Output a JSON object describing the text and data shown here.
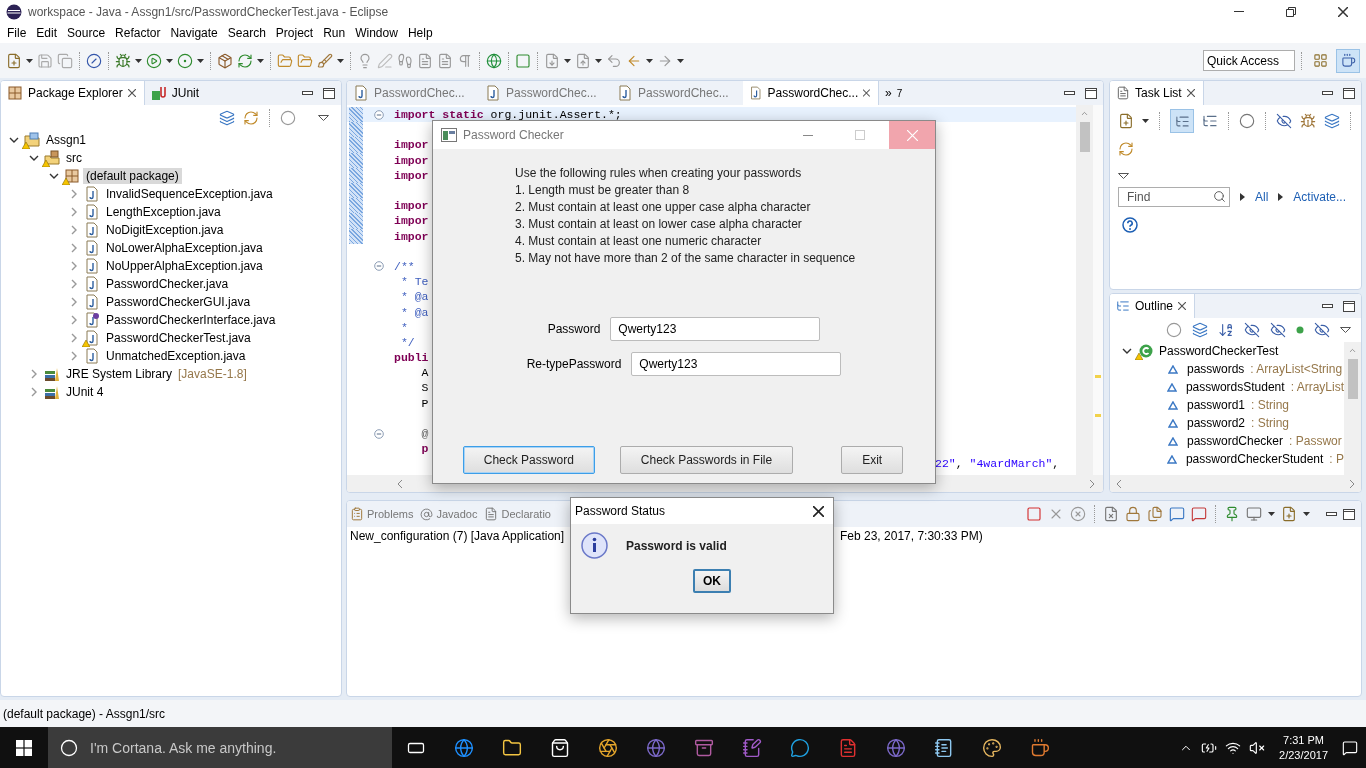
{
  "window": {
    "title": "workspace - Java - Assgn1/src/PasswordCheckerTest.java - Eclipse"
  },
  "menu": [
    {
      "label": "File"
    },
    {
      "label": "Edit"
    },
    {
      "label": "Source"
    },
    {
      "label": "Refactor"
    },
    {
      "label": "Navigate"
    },
    {
      "label": "Search"
    },
    {
      "label": "Project"
    },
    {
      "label": "Run"
    },
    {
      "label": "Window"
    },
    {
      "label": "Help"
    }
  ],
  "quick_access": {
    "placeholder": "Quick Access"
  },
  "package_explorer": {
    "tabs": [
      {
        "label": "Package Explorer",
        "selected": true,
        "kind": "explorer"
      },
      {
        "label": "JUnit",
        "selected": false,
        "kind": "junit"
      }
    ],
    "tree": [
      {
        "label": "Assgn1",
        "kind": "project",
        "expanded": true,
        "warning": true,
        "selected": false,
        "children": [
          {
            "label": "src",
            "kind": "source-folder",
            "expanded": true,
            "warning": true,
            "selected": false,
            "children": [
              {
                "label": "(default package)",
                "kind": "package",
                "expanded": true,
                "warning": true,
                "selected": true,
                "children": [
                  {
                    "label": "InvalidSequenceException.java",
                    "kind": "class",
                    "expanded": false,
                    "warning": false,
                    "selected": false
                  },
                  {
                    "label": "LengthException.java",
                    "kind": "class",
                    "expanded": false,
                    "warning": false,
                    "selected": false
                  },
                  {
                    "label": "NoDigitException.java",
                    "kind": "class",
                    "expanded": false,
                    "warning": false,
                    "selected": false
                  },
                  {
                    "label": "NoLowerAlphaException.java",
                    "kind": "class",
                    "expanded": false,
                    "warning": false,
                    "selected": false
                  },
                  {
                    "label": "NoUpperAlphaException.java",
                    "kind": "class",
                    "expanded": false,
                    "warning": false,
                    "selected": false
                  },
                  {
                    "label": "PasswordChecker.java",
                    "kind": "class",
                    "expanded": false,
                    "warning": false,
                    "selected": false
                  },
                  {
                    "label": "PasswordCheckerGUI.java",
                    "kind": "class",
                    "expanded": false,
                    "warning": false,
                    "selected": false
                  },
                  {
                    "label": "PasswordCheckerInterface.java",
                    "kind": "interface",
                    "expanded": false,
                    "warning": false,
                    "selected": false
                  },
                  {
                    "label": "PasswordCheckerTest.java",
                    "kind": "class",
                    "expanded": false,
                    "warning": true,
                    "selected": false
                  },
                  {
                    "label": "UnmatchedException.java",
                    "kind": "class",
                    "expanded": false,
                    "warning": false,
                    "selected": false
                  }
                ]
              }
            ]
          },
          {
            "label": "JRE System Library",
            "suffix": "[JavaSE-1.8]",
            "kind": "library",
            "expanded": false,
            "warning": false,
            "selected": false
          },
          {
            "label": "JUnit 4",
            "kind": "library",
            "expanded": false,
            "warning": false,
            "selected": false
          }
        ]
      }
    ]
  },
  "editor": {
    "tabs": [
      {
        "label": "PasswordChec...",
        "selected": false
      },
      {
        "label": "PasswordChec...",
        "selected": false
      },
      {
        "label": "PasswordChec...",
        "selected": false
      },
      {
        "label": "PasswordChec...",
        "selected": true
      }
    ],
    "overflow": {
      "glyph": "»",
      "count": "7"
    },
    "lines": [
      {
        "tokens": [
          {
            "text": "import static",
            "kind": "keyword"
          },
          {
            "text": " org.junit.Assert.*;",
            "kind": "plain"
          }
        ],
        "fold": true,
        "current": true,
        "marked": true
      },
      {
        "fold": false,
        "current": false,
        "marked": true
      },
      {
        "tokens": [
          {
            "text": "impor",
            "kind": "keyword"
          }
        ],
        "fold": false,
        "current": false,
        "marked": true
      },
      {
        "tokens": [
          {
            "text": "impor",
            "kind": "keyword"
          }
        ],
        "fold": false,
        "current": false,
        "marked": true
      },
      {
        "tokens": [
          {
            "text": "impor",
            "kind": "keyword"
          }
        ],
        "fold": false,
        "current": false,
        "marked": true
      },
      {
        "fold": false,
        "current": false,
        "marked": true
      },
      {
        "tokens": [
          {
            "text": "impor",
            "kind": "keyword"
          }
        ],
        "fold": false,
        "current": false,
        "marked": true
      },
      {
        "tokens": [
          {
            "text": "impor",
            "kind": "keyword"
          }
        ],
        "fold": false,
        "current": false,
        "marked": true
      },
      {
        "tokens": [
          {
            "text": "impor",
            "kind": "keyword"
          }
        ],
        "fold": false,
        "current": false,
        "marked": true
      },
      {
        "fold": false,
        "current": false,
        "marked": false
      },
      {
        "tokens": [
          {
            "text": "/**",
            "kind": "comment"
          }
        ],
        "fold": true,
        "current": false,
        "marked": false
      },
      {
        "tokens": [
          {
            "text": " * Te",
            "kind": "comment"
          }
        ],
        "fold": false,
        "current": false,
        "marked": false
      },
      {
        "tokens": [
          {
            "text": " * @a",
            "kind": "comment"
          }
        ],
        "fold": false,
        "current": false,
        "marked": false
      },
      {
        "tokens": [
          {
            "text": " * @a",
            "kind": "comment"
          }
        ],
        "fold": false,
        "current": false,
        "marked": false
      },
      {
        "tokens": [
          {
            "text": " *",
            "kind": "comment"
          }
        ],
        "fold": false,
        "current": false,
        "marked": false
      },
      {
        "tokens": [
          {
            "text": " */",
            "kind": "comment"
          }
        ],
        "fold": false,
        "current": false,
        "marked": false
      },
      {
        "tokens": [
          {
            "text": "publi",
            "kind": "keyword"
          }
        ],
        "fold": false,
        "current": false,
        "marked": false
      },
      {
        "tokens": [
          {
            "text": "    A",
            "kind": "plain"
          }
        ],
        "fold": false,
        "current": false,
        "marked": false
      },
      {
        "tokens": [
          {
            "text": "    S",
            "kind": "plain"
          }
        ],
        "fold": false,
        "current": false,
        "marked": false
      },
      {
        "tokens": [
          {
            "text": "    P",
            "kind": "plain"
          }
        ],
        "fold": false,
        "current": false,
        "marked": false
      },
      {
        "fold": false,
        "current": false,
        "marked": false
      },
      {
        "tokens": [
          {
            "text": "    @",
            "kind": "annotation"
          }
        ],
        "fold": true,
        "current": false,
        "marked": false
      },
      {
        "tokens": [
          {
            "text": "    p",
            "kind": "keyword"
          }
        ],
        "fold": false,
        "current": false,
        "marked": false
      },
      {
        "right": [
          {
            "text": "22\"",
            "kind": "string"
          },
          {
            "text": ", ",
            "kind": "plain"
          },
          {
            "text": "\"4wardMarch\"",
            "kind": "string"
          },
          {
            "text": ",",
            "kind": "plain"
          }
        ],
        "fold": false,
        "current": false,
        "marked": false
      }
    ]
  },
  "task_list": {
    "title": "Task List",
    "selected": true,
    "find": {
      "placeholder": "Find"
    },
    "links": [
      {
        "label": "All"
      },
      {
        "label": "Activate..."
      }
    ]
  },
  "outline": {
    "title": "Outline",
    "selected": true,
    "tree": [
      {
        "label": "PasswordCheckerTest",
        "kind": "class",
        "expanded": true,
        "warning": true,
        "children": [
          {
            "label": "passwords",
            "type": ": ArrayList<String",
            "kind": "field"
          },
          {
            "label": "passwordsStudent",
            "type": ": ArrayList",
            "kind": "field"
          },
          {
            "label": "password1",
            "type": ": String",
            "kind": "field"
          },
          {
            "label": "password2",
            "type": ": String",
            "kind": "field"
          },
          {
            "label": "passwordChecker",
            "type": ": Passwor",
            "kind": "field"
          },
          {
            "label": "passwordCheckerStudent",
            "type": ": P",
            "kind": "field"
          }
        ]
      }
    ]
  },
  "console": {
    "tabs": [
      {
        "label": "Problems",
        "kind": "problems",
        "selected": false
      },
      {
        "label": "Javadoc",
        "kind": "javadoc",
        "selected": false
      },
      {
        "label": "Declaratio",
        "kind": "declaration",
        "selected": false
      }
    ],
    "header": "New_configuration (7) [Java Application]",
    "header_end": "Feb 23, 2017, 7:30:33 PM)"
  },
  "password_checker": {
    "title": "Password Checker",
    "close_hovered": true,
    "instructions": [
      "Use the following rules when creating your passwords",
      "1. Length must be greater than 8",
      "2. Must contain at least one upper case alpha character",
      "3. Must contain at least on lower case alpha character",
      "4. Must contain at least one numeric character",
      "5. May not have more than 2 of the same character in sequence"
    ],
    "fields": [
      {
        "label": "Password",
        "value": "Qwerty123"
      },
      {
        "label": "Re-typePassword",
        "value": "Qwerty123"
      }
    ],
    "buttons": [
      {
        "label": "Check Password",
        "focused": true
      },
      {
        "label": "Check Passwords in File",
        "focused": false
      },
      {
        "label": "Exit",
        "focused": false
      }
    ]
  },
  "password_status": {
    "title": "Password Status",
    "message": "Password is valid",
    "button": {
      "label": "OK",
      "focused": true
    }
  },
  "status_bar": {
    "text": "(default package) - Assgn1/src"
  },
  "taskbar": {
    "search": {
      "placeholder": "I'm Cortana. Ask me anything."
    },
    "time": "7:31 PM",
    "date": "2/23/2017"
  }
}
